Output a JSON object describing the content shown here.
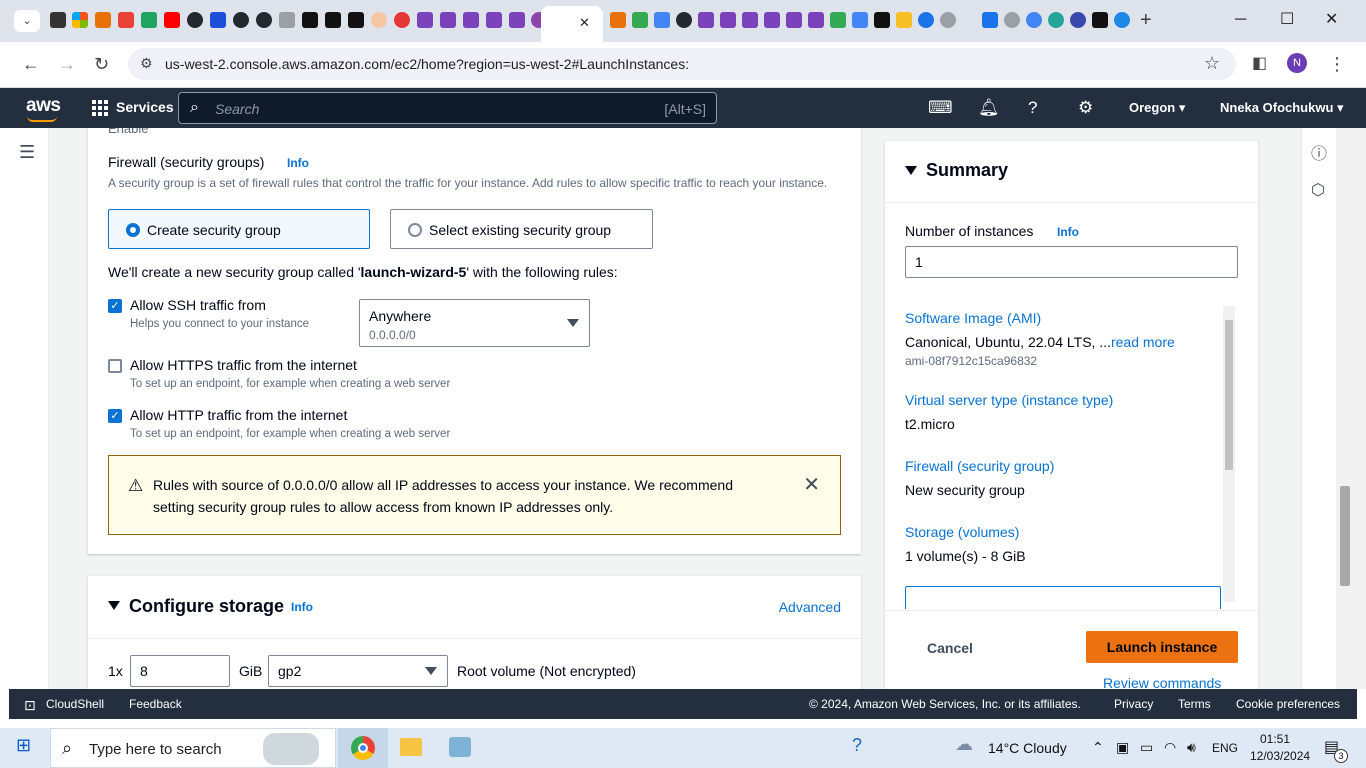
{
  "browser": {
    "url": "us-west-2.console.aws.amazon.com/ec2/home?region=us-west-2#LaunchInstances:",
    "profile_initial": "N",
    "active_tab_close": "✕",
    "new_tab": "+",
    "tab_search": "⌄"
  },
  "aws_nav": {
    "logo": "aws",
    "services": "Services",
    "search_placeholder": "Search",
    "search_shortcut": "[Alt+S]",
    "region": "Oregon ▾",
    "user": "Nneka Ofochukwu ▾"
  },
  "network": {
    "partial_text": "Enable",
    "firewall_label": "Firewall (security groups)",
    "info": "Info",
    "firewall_desc": "A security group is a set of firewall rules that control the traffic for your instance. Add rules to allow specific traffic to reach your instance.",
    "option_create": "Create security group",
    "option_select": "Select existing security group",
    "new_group_prefix": "We'll create a new security group called '",
    "new_group_name": "launch-wizard-5",
    "new_group_suffix": "' with the following rules:",
    "rules": [
      {
        "label": "Allow SSH traffic from",
        "hint": "Helps you connect to your instance",
        "checked": true
      },
      {
        "label": "Allow HTTPS traffic from the internet",
        "hint": "To set up an endpoint, for example when creating a web server",
        "checked": false
      },
      {
        "label": "Allow HTTP traffic from the internet",
        "hint": "To set up an endpoint, for example when creating a web server",
        "checked": true
      }
    ],
    "ssh_source": "Anywhere",
    "ssh_source_sub": "0.0.0.0/0",
    "warning": "Rules with source of 0.0.0.0/0 allow all IP addresses to access your instance. We recommend setting security group rules to allow access from known IP addresses only."
  },
  "storage": {
    "title": "Configure storage",
    "info": "Info",
    "advanced": "Advanced",
    "count_prefix": "1x",
    "size": "8",
    "unit": "GiB",
    "volume_type": "gp2",
    "root_label": "Root volume  (Not encrypted)"
  },
  "summary": {
    "title": "Summary",
    "instances_label": "Number of instances",
    "info": "Info",
    "instances_value": "1",
    "ami_label": "Software Image (AMI)",
    "ami_value": "Canonical, Ubuntu, 22.04 LTS, ...",
    "ami_more": "read more",
    "ami_id": "ami-08f7912c15ca96832",
    "type_label": "Virtual server type (instance type)",
    "type_value": "t2.micro",
    "fw_label": "Firewall (security group)",
    "fw_value": "New security group",
    "storage_label": "Storage (volumes)",
    "storage_value": "1 volume(s) - 8 GiB",
    "cancel": "Cancel",
    "launch": "Launch instance",
    "review": "Review commands"
  },
  "footer": {
    "cloudshell": "CloudShell",
    "feedback": "Feedback",
    "copyright": "© 2024, Amazon Web Services, Inc. or its affiliates.",
    "privacy": "Privacy",
    "terms": "Terms",
    "cookies": "Cookie preferences"
  },
  "taskbar": {
    "search_placeholder": "Type here to search",
    "weather": "14°C  Cloudy",
    "lang": "ENG",
    "time": "01:51",
    "date": "12/03/2024",
    "notif_count": "3"
  },
  "colors": {
    "aws_nav": "#232f3e",
    "aws_orange": "#ff9900",
    "link_blue": "#0972d3",
    "launch_button": "#ec7211",
    "warning_bg": "#fffce9"
  }
}
